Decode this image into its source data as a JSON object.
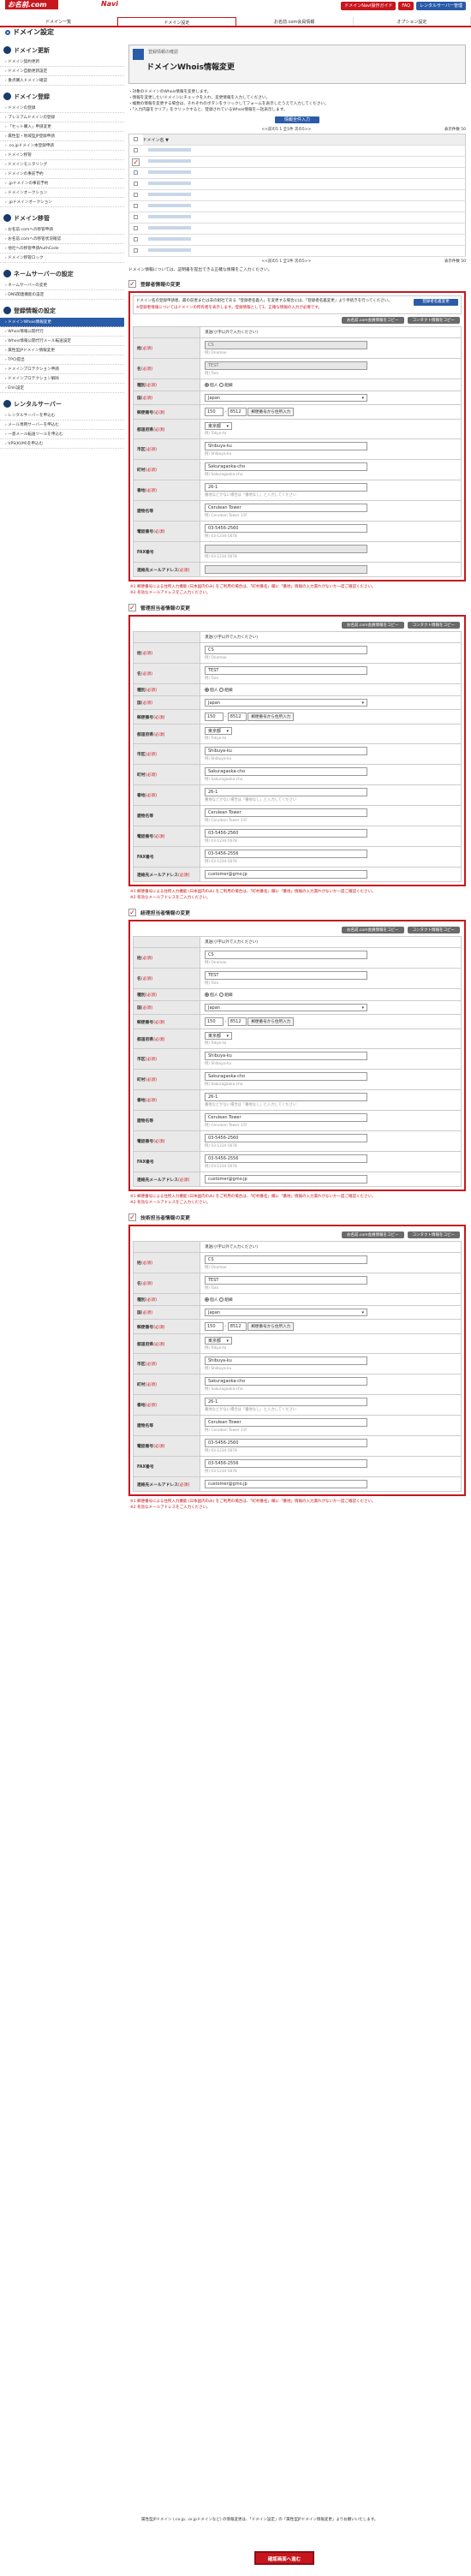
{
  "header": {
    "logo": "お名前.com",
    "sublogo": "Navi",
    "guide": "ドメインNavi操作ガイド",
    "faq": "FAQ",
    "server_login": "レンタルサーバー管理"
  },
  "gnav": [
    "ドメイン一覧",
    "ドメイン設定",
    "お名前.com会員情報",
    "オプション設定"
  ],
  "page_title": "ドメイン設定",
  "sidebar": [
    {
      "title": "ドメイン更新",
      "items": [
        "ドメイン契約更新",
        "ドメイン自動更新設定",
        "重点購入ドメイン確認"
      ]
    },
    {
      "title": "ドメイン登録",
      "items": [
        "ドメインの登録",
        "プレミアムドメインの登録",
        "「セット購入」申請変更",
        "属性型・地域型JP登録申請",
        ".co.jpドメイン本登録申請",
        "ドメイン移管",
        "ドメインモニタリング",
        "ドメインの事前予約",
        ".jpドメインの事前予約",
        "ドメインオークション",
        ".jpドメインオークション"
      ]
    },
    {
      "title": "ドメイン移管",
      "items": [
        "お名前.comへの移管申請",
        "お名前.comへの移管状況確認",
        "他社への移管申請AuthCode",
        "ドメイン移管ロック"
      ]
    },
    {
      "title": "ネームサーバーの設定",
      "items": [
        "ネームサーバーの変更",
        "DNS関連機能の設定"
      ]
    },
    {
      "title": "登録情報の設定",
      "items": [
        "ドメインWhois情報変更",
        "Whois情報公開代行",
        "Whois情報公開代行メール転送設定",
        "属性型JPドメイン情報変更",
        "TPCI提出",
        "ドメインプロテクション申請",
        "ドメインプロテクション解除",
        "Ehls設定"
      ]
    },
    {
      "title": "レンタルサーバー",
      "items": [
        "レンタルサーバーを申込む",
        "メール専用サーバーを申込む",
        "一意メール転送ツールを申込む",
        "VPS(KVM)を申込む"
      ]
    }
  ],
  "banner": {
    "caption": "登録情報の確認",
    "title": "ドメインWhois情報変更"
  },
  "intro": "・対象のドメインのWhois情報を変更します。\n・情報を変更したいドメインにチェックを入れ、変更情報を入力してください。\n・複数の情報を変更する場合は、それぞれのボタンをクリックしてフォームを表示したうえで入力してください。\n・「入力内容をクリア」をクリックすると、登録されているWhois情報を一括表示します。",
  "select_button": "情報全件入力",
  "pager_top": "<<前の5 1 全1件 次の5>>",
  "per_page": "表示件数 50",
  "domains": [
    "a",
    "b",
    "c",
    "d",
    "e",
    "f",
    "g",
    "h",
    "i",
    "j"
  ],
  "checked_index": 1,
  "note_registrant": "ドメイン情報については、証明書を提出できる正確な情報をご入力ください。",
  "sections": [
    {
      "title": "登録者情報の変更",
      "info": "ドメイン名の登録申請者、最の前者または非の組社である「登録者名義人」を変更する場合には、「登録者名義変更」より手続きを行ってください。",
      "info2": "※登録者情報についてはドメインの所有者を表示します。登録情報として1、正確な情報の入力が必要です。",
      "btn": "登録者名義変更",
      "name": "registrant"
    },
    {
      "title": "管理担当者情報の変更",
      "name": "admin"
    },
    {
      "title": "経理担当者情報の変更",
      "name": "billing"
    },
    {
      "title": "技術担当者情報の変更",
      "name": "tech"
    }
  ],
  "copy_btn1": "お名前.com会員情報をコピー",
  "copy_btn2": "コンタクト情報をコピー",
  "form": {
    "lbl_input": "漢送(小字以外で入力ください)",
    "lbl_name_sei": "姓",
    "lbl_name_mei": "名",
    "lbl_type": "種別",
    "lbl_country": "国",
    "lbl_zip": "郵便番号",
    "lbl_pref": "都道府県",
    "lbl_city": "市区",
    "lbl_town": "町村",
    "lbl_addr": "番地",
    "lbl_bldg": "建物名等",
    "lbl_tel": "電話番号",
    "lbl_fax": "FAX番号",
    "lbl_email": "連絡先メールアドレス",
    "required": "(必須)",
    "sei": "CS",
    "mei": "TEST",
    "type_person": "個人",
    "type_org": "組織",
    "country": "Japan",
    "zip1": "150",
    "zip2": "8512",
    "zip_btn": "郵便番号から住所入力",
    "pref": "東京都",
    "city": "Shibuya-ku",
    "town": "Sakuragaoka-cho",
    "addr": "26-1",
    "bldg": "Cerulean Tower",
    "tel": "03-5456-2560",
    "fax": "03-5456-2556",
    "email": "customer@gmo.jp",
    "ex_sei": "例) Onamae",
    "ex_mei": "例) Taro",
    "ex_pref": "例) Tokyo-to",
    "ex_city": "例) Shibuya-ku",
    "ex_town": "例) Sakuragaoka-cho",
    "ex_addr": "例) 26-1",
    "ex_addr2": "番地などがない場合は「番地なし」と入力してください",
    "ex_bldg": "例) Cerulean Tower 11F",
    "ex_tel": "例) 03-1234-5678",
    "ex_fax": "例) 03-1234-5678"
  },
  "foot1": "※1 郵便番号による住所入力機能 (日本国内のみ) をご利用の場合は、「町村番名」欄に「番地」情報の入力漏れがないか一度ご確認ください。",
  "foot2": "※2 有効なメールアドレスをご入力ください。",
  "final_note": "属性型JPドメイン (.co.jp, .or.jpドメインなど) の情報変更は、「ドメイン設定」の「属性型JPドメイン情報変更」よりお願いいたします。",
  "submit": "確認画面へ進む"
}
